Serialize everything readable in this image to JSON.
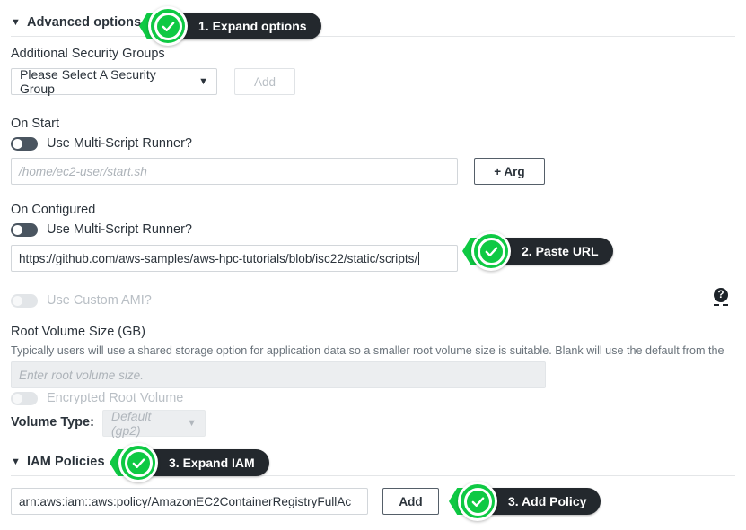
{
  "sections": {
    "advanced": {
      "title": "Advanced options",
      "caret": "▼"
    },
    "iam": {
      "title": "IAM Policies",
      "caret": "▼"
    }
  },
  "security_groups": {
    "label": "Additional Security Groups",
    "select_value": "Please Select A Security Group",
    "select_arrow": "▼",
    "add_label": "Add"
  },
  "on_start": {
    "label": "On Start",
    "toggle_label": "Use Multi-Script Runner?",
    "input_placeholder": "/home/ec2-user/start.sh",
    "arg_label": "+ Arg"
  },
  "on_configured": {
    "label": "On Configured",
    "toggle_label": "Use Multi-Script Runner?",
    "input_value": "https://github.com/aws-samples/aws-hpc-tutorials/blob/isc22/static/scripts/"
  },
  "custom_ami": {
    "toggle_label": "Use Custom AMI?"
  },
  "help": {
    "glyph": "?"
  },
  "root_volume": {
    "label": "Root Volume Size (GB)",
    "help_text": "Typically users will use a shared storage option for application data so a smaller root volume size is suitable. Blank will use the default from the AMI.",
    "input_placeholder": "Enter root volume size.",
    "encrypted_toggle_label": "Encrypted Root Volume",
    "volume_type_label": "Volume Type:",
    "volume_type_value": "Default (gp2)",
    "volume_type_arrow": "▼"
  },
  "iam_policy": {
    "input_value": "arn:aws:iam::aws:policy/AmazonEC2ContainerRegistryFullAc",
    "add_label": "Add"
  },
  "annotations": [
    {
      "text": "1. Expand options"
    },
    {
      "text": "2. Paste URL"
    },
    {
      "text": "3. Expand IAM"
    },
    {
      "text": "3. Add Policy"
    }
  ],
  "colors": {
    "accent_green": "#0ec943",
    "pill_dark": "#23282d",
    "text": "#2b333b",
    "muted": "#b9bfc5"
  }
}
